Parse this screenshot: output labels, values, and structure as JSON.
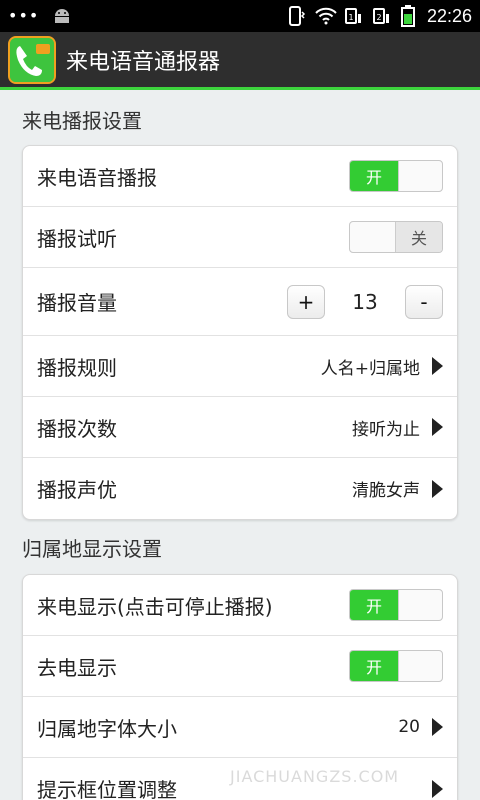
{
  "status_bar": {
    "time": "22:26"
  },
  "app": {
    "title": "来电语音通报器"
  },
  "sections": [
    {
      "header": "来电播报设置",
      "rows": {
        "voice_broadcast": {
          "label": "来电语音播报",
          "toggle_text": "开"
        },
        "preview": {
          "label": "播报试听",
          "toggle_text": "关"
        },
        "volume": {
          "label": "播报音量",
          "plus": "+",
          "value": "13",
          "minus": "-"
        },
        "rule": {
          "label": "播报规则",
          "value": "人名+归属地"
        },
        "count": {
          "label": "播报次数",
          "value": "接听为止"
        },
        "voice": {
          "label": "播报声优",
          "value": "清脆女声"
        }
      }
    },
    {
      "header": "归属地显示设置",
      "rows": {
        "incoming_display": {
          "label": "来电显示(点击可停止播报)",
          "toggle_text": "开"
        },
        "outgoing_display": {
          "label": "去电显示",
          "toggle_text": "开"
        },
        "font_size": {
          "label": "归属地字体大小",
          "value": "20"
        },
        "position": {
          "label": "提示框位置调整"
        }
      }
    }
  ],
  "watermark": "JIACHUANGZS.COM",
  "colors": {
    "accent": "#33cc33",
    "action_bar": "#2e2e2e",
    "background": "#eceff0"
  }
}
